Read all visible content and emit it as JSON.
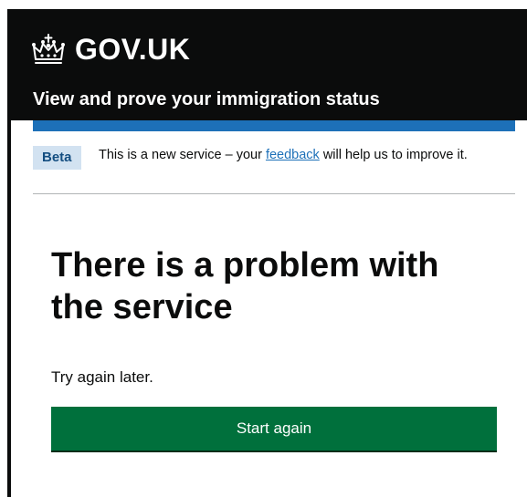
{
  "header": {
    "logo_text": "GOV.UK",
    "service_name": "View and prove your immigration status"
  },
  "phase_banner": {
    "tag": "Beta",
    "text_before": "This is a new service – your ",
    "link_text": "feedback",
    "text_after": " will help us to improve it."
  },
  "main": {
    "heading": "There is a problem with the service",
    "body": "Try again later.",
    "button_label": "Start again"
  },
  "icons": {
    "logo_icon": "crown-icon"
  },
  "colors": {
    "header_bg": "#0b0c0c",
    "accent_blue": "#1d70b8",
    "tag_bg": "#d2e2f1",
    "tag_text": "#144e81",
    "button_green": "#00703c"
  }
}
